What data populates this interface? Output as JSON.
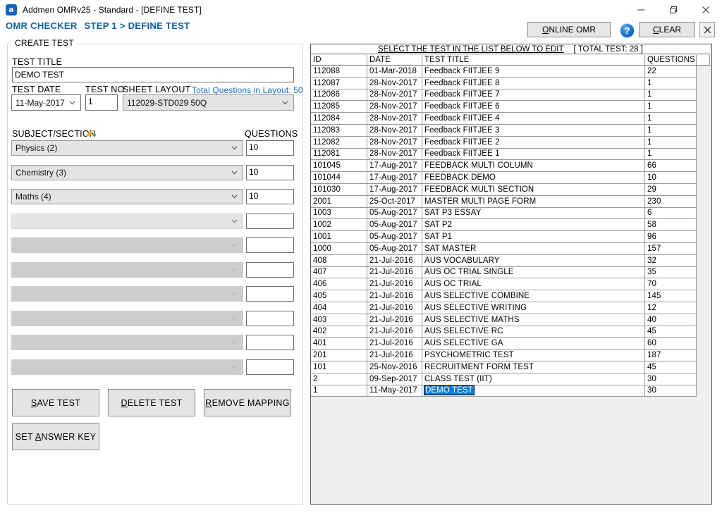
{
  "window": {
    "app_icon": "a",
    "title": "Addmen OMRv25 - Standard - [DEFINE TEST]",
    "minimize_icon": "minimize-icon",
    "maximize_icon": "maximize-icon",
    "close_icon": "close-icon"
  },
  "header": {
    "app_name": "OMR CHECKER",
    "breadcrumb": "STEP 1 > DEFINE TEST",
    "online_omr_button": "ONLINE OMR",
    "online_omr_mnemonic": "O",
    "help_button": "?",
    "clear_button": "CLEAR",
    "clear_mnemonic": "C",
    "close_button": "✕"
  },
  "create_test": {
    "legend": "CREATE TEST",
    "test_title_label": "TEST TITLE",
    "test_title_value": "DEMO TEST",
    "test_date_label": "TEST DATE",
    "test_date_value": "11-May-2017",
    "test_no_label": "TEST NO",
    "test_no_value": "1",
    "sheet_layout_label": "SHEET LAYOUT",
    "sheet_layout_value": "112029-STD029 50Q",
    "total_questions_note": "Total Questions in Layout: 50",
    "subject_section_label": "SUBJECT/SECTION",
    "subject_section_icon": "pencil-add-icon",
    "questions_label": "QUESTIONS",
    "sections": [
      {
        "subject": "Physics (2)",
        "questions": "10",
        "state": "filled"
      },
      {
        "subject": "Chemistry (3)",
        "questions": "10",
        "state": "filled"
      },
      {
        "subject": "Maths (4)",
        "questions": "10",
        "state": "filled"
      },
      {
        "subject": "",
        "questions": "",
        "state": "enabled"
      },
      {
        "subject": "",
        "questions": "",
        "state": "disabled"
      },
      {
        "subject": "",
        "questions": "",
        "state": "disabled"
      },
      {
        "subject": "",
        "questions": "",
        "state": "disabled"
      },
      {
        "subject": "",
        "questions": "",
        "state": "disabled"
      },
      {
        "subject": "",
        "questions": "",
        "state": "disabled"
      },
      {
        "subject": "",
        "questions": "",
        "state": "disabled"
      }
    ],
    "buttons": {
      "save_test": "SAVE TEST",
      "save_test_mnemonic": "S",
      "delete_test": "DELETE TEST",
      "delete_test_mnemonic": "D",
      "remove_mapping": "REMOVE MAPPING",
      "remove_mapping_mnemonic": "R",
      "set_answer_key": "SET ANSWER KEY",
      "set_answer_key_mnemonic": "A"
    }
  },
  "test_list": {
    "caption_main": "SELECT THE TEST IN THE LIST BELOW TO EDIT",
    "caption_total": "[ TOTAL TEST: 28 ]",
    "columns": [
      "ID",
      "DATE",
      "TEST TITLE",
      "QUESTIONS",
      ""
    ],
    "selected_row_index": 27,
    "selected_cell_column": "TEST TITLE",
    "selection_color": "#0b7bd4",
    "rows": [
      {
        "id": "112088",
        "date": "01-Mar-2018",
        "title": "Feedback FIITJEE 9",
        "questions": "22"
      },
      {
        "id": "112087",
        "date": "28-Nov-2017",
        "title": "Feedback FIITJEE 8",
        "questions": "1"
      },
      {
        "id": "112086",
        "date": "28-Nov-2017",
        "title": "Feedback FIITJEE 7",
        "questions": "1"
      },
      {
        "id": "112085",
        "date": "28-Nov-2017",
        "title": "Feedback FIITJEE 6",
        "questions": "1"
      },
      {
        "id": "112084",
        "date": "28-Nov-2017",
        "title": "Feedback FIITJEE 4",
        "questions": "1"
      },
      {
        "id": "112083",
        "date": "28-Nov-2017",
        "title": "Feedback FIITJEE 3",
        "questions": "1"
      },
      {
        "id": "112082",
        "date": "28-Nov-2017",
        "title": "Feedback FIITJEE 2",
        "questions": "1"
      },
      {
        "id": "112081",
        "date": "28-Nov-2017",
        "title": "Feedback FIITJEE 1",
        "questions": "1"
      },
      {
        "id": "101045",
        "date": "17-Aug-2017",
        "title": "FEEDBACK MULTI COLUMN",
        "questions": "66"
      },
      {
        "id": "101044",
        "date": "17-Aug-2017",
        "title": "FEEDBACK DEMO",
        "questions": "10"
      },
      {
        "id": "101030",
        "date": "17-Aug-2017",
        "title": "FEEDBACK MULTI SECTION",
        "questions": "29"
      },
      {
        "id": "2001",
        "date": "25-Oct-2017",
        "title": "MASTER MULTI PAGE FORM",
        "questions": "230"
      },
      {
        "id": "1003",
        "date": "05-Aug-2017",
        "title": "SAT P3 ESSAY",
        "questions": "6"
      },
      {
        "id": "1002",
        "date": "05-Aug-2017",
        "title": "SAT P2",
        "questions": "58"
      },
      {
        "id": "1001",
        "date": "05-Aug-2017",
        "title": "SAT P1",
        "questions": "96"
      },
      {
        "id": "1000",
        "date": "05-Aug-2017",
        "title": "SAT MASTER",
        "questions": "157"
      },
      {
        "id": "408",
        "date": "21-Jul-2016",
        "title": "AUS VOCABULARY",
        "questions": "32"
      },
      {
        "id": "407",
        "date": "21-Jul-2016",
        "title": "AUS OC TRIAL SINGLE",
        "questions": "35"
      },
      {
        "id": "406",
        "date": "21-Jul-2016",
        "title": "AUS OC TRIAL",
        "questions": "70"
      },
      {
        "id": "405",
        "date": "21-Jul-2016",
        "title": "AUS SELECTIVE COMBINE",
        "questions": "145"
      },
      {
        "id": "404",
        "date": "21-Jul-2016",
        "title": "AUS SELECTIVE WRITING",
        "questions": "12"
      },
      {
        "id": "403",
        "date": "21-Jul-2016",
        "title": "AUS SELECTIVE MATHS",
        "questions": "40"
      },
      {
        "id": "402",
        "date": "21-Jul-2016",
        "title": "AUS SELECTIVE RC",
        "questions": "45"
      },
      {
        "id": "401",
        "date": "21-Jul-2016",
        "title": "AUS SELECTIVE GA",
        "questions": "60"
      },
      {
        "id": "201",
        "date": "21-Jul-2016",
        "title": "PSYCHOMETRIC  TEST",
        "questions": "187"
      },
      {
        "id": "101",
        "date": "25-Nov-2016",
        "title": "RECRUITMENT FORM TEST",
        "questions": "45"
      },
      {
        "id": "2",
        "date": "09-Sep-2017",
        "title": "CLASS TEST (IIT)",
        "questions": "30"
      },
      {
        "id": "1",
        "date": "11-May-2017",
        "title": "DEMO TEST",
        "questions": "30"
      }
    ]
  }
}
